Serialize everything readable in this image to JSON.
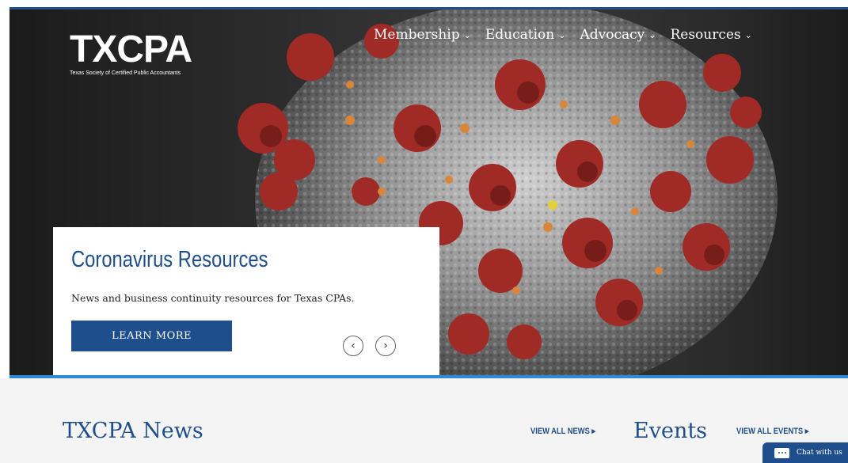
{
  "logo": {
    "mark": "TXCPA",
    "tagline": "Texas Society of Certified Public Accountants"
  },
  "nav": {
    "items": [
      {
        "label": "Membership"
      },
      {
        "label": "Education"
      },
      {
        "label": "Advocacy"
      },
      {
        "label": "Resources"
      }
    ],
    "chevron": "⌄"
  },
  "hero": {
    "image": "coronavirus-illustration",
    "card": {
      "title": "Coronavirus Resources",
      "description": "News and business continuity resources for Texas CPAs.",
      "button_label": "LEARN MORE",
      "prev_icon": "chevron-left-icon",
      "next_icon": "chevron-right-icon"
    }
  },
  "news": {
    "title": "TXCPA News",
    "view_all": "VIEW ALL NEWS ▸"
  },
  "events": {
    "title": "Events",
    "view_all": "VIEW ALL EVENTS ▸"
  },
  "chat": {
    "label": "Chat with us",
    "icon": "chat-bubble-icon"
  },
  "colors": {
    "brand_blue": "#1f4e8c",
    "accent_blue": "#2f8ad6",
    "spike_red": "#a02a26",
    "virus_gray": "#9a9a9a"
  }
}
